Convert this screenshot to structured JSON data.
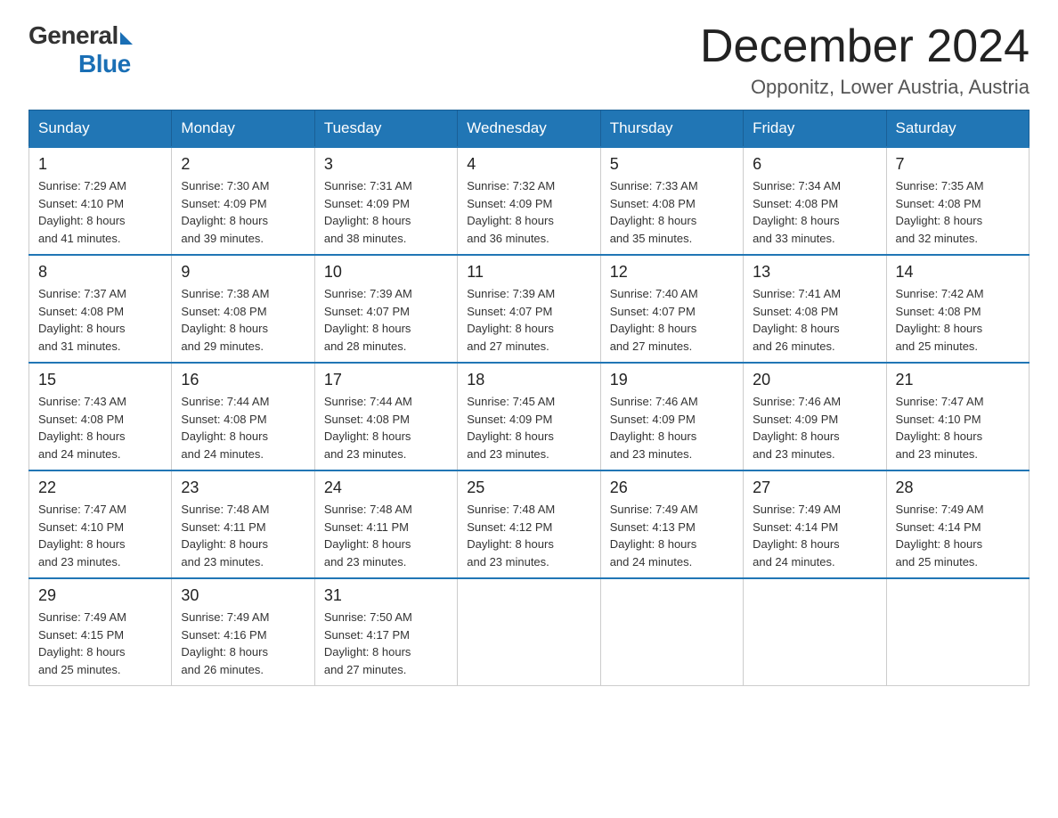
{
  "logo": {
    "general": "General",
    "blue": "Blue"
  },
  "title": "December 2024",
  "subtitle": "Opponitz, Lower Austria, Austria",
  "days_header": [
    "Sunday",
    "Monday",
    "Tuesday",
    "Wednesday",
    "Thursday",
    "Friday",
    "Saturday"
  ],
  "weeks": [
    [
      {
        "day": "1",
        "sunrise": "7:29 AM",
        "sunset": "4:10 PM",
        "daylight": "8 hours and 41 minutes."
      },
      {
        "day": "2",
        "sunrise": "7:30 AM",
        "sunset": "4:09 PM",
        "daylight": "8 hours and 39 minutes."
      },
      {
        "day": "3",
        "sunrise": "7:31 AM",
        "sunset": "4:09 PM",
        "daylight": "8 hours and 38 minutes."
      },
      {
        "day": "4",
        "sunrise": "7:32 AM",
        "sunset": "4:09 PM",
        "daylight": "8 hours and 36 minutes."
      },
      {
        "day": "5",
        "sunrise": "7:33 AM",
        "sunset": "4:08 PM",
        "daylight": "8 hours and 35 minutes."
      },
      {
        "day": "6",
        "sunrise": "7:34 AM",
        "sunset": "4:08 PM",
        "daylight": "8 hours and 33 minutes."
      },
      {
        "day": "7",
        "sunrise": "7:35 AM",
        "sunset": "4:08 PM",
        "daylight": "8 hours and 32 minutes."
      }
    ],
    [
      {
        "day": "8",
        "sunrise": "7:37 AM",
        "sunset": "4:08 PM",
        "daylight": "8 hours and 31 minutes."
      },
      {
        "day": "9",
        "sunrise": "7:38 AM",
        "sunset": "4:08 PM",
        "daylight": "8 hours and 29 minutes."
      },
      {
        "day": "10",
        "sunrise": "7:39 AM",
        "sunset": "4:07 PM",
        "daylight": "8 hours and 28 minutes."
      },
      {
        "day": "11",
        "sunrise": "7:39 AM",
        "sunset": "4:07 PM",
        "daylight": "8 hours and 27 minutes."
      },
      {
        "day": "12",
        "sunrise": "7:40 AM",
        "sunset": "4:07 PM",
        "daylight": "8 hours and 27 minutes."
      },
      {
        "day": "13",
        "sunrise": "7:41 AM",
        "sunset": "4:08 PM",
        "daylight": "8 hours and 26 minutes."
      },
      {
        "day": "14",
        "sunrise": "7:42 AM",
        "sunset": "4:08 PM",
        "daylight": "8 hours and 25 minutes."
      }
    ],
    [
      {
        "day": "15",
        "sunrise": "7:43 AM",
        "sunset": "4:08 PM",
        "daylight": "8 hours and 24 minutes."
      },
      {
        "day": "16",
        "sunrise": "7:44 AM",
        "sunset": "4:08 PM",
        "daylight": "8 hours and 24 minutes."
      },
      {
        "day": "17",
        "sunrise": "7:44 AM",
        "sunset": "4:08 PM",
        "daylight": "8 hours and 23 minutes."
      },
      {
        "day": "18",
        "sunrise": "7:45 AM",
        "sunset": "4:09 PM",
        "daylight": "8 hours and 23 minutes."
      },
      {
        "day": "19",
        "sunrise": "7:46 AM",
        "sunset": "4:09 PM",
        "daylight": "8 hours and 23 minutes."
      },
      {
        "day": "20",
        "sunrise": "7:46 AM",
        "sunset": "4:09 PM",
        "daylight": "8 hours and 23 minutes."
      },
      {
        "day": "21",
        "sunrise": "7:47 AM",
        "sunset": "4:10 PM",
        "daylight": "8 hours and 23 minutes."
      }
    ],
    [
      {
        "day": "22",
        "sunrise": "7:47 AM",
        "sunset": "4:10 PM",
        "daylight": "8 hours and 23 minutes."
      },
      {
        "day": "23",
        "sunrise": "7:48 AM",
        "sunset": "4:11 PM",
        "daylight": "8 hours and 23 minutes."
      },
      {
        "day": "24",
        "sunrise": "7:48 AM",
        "sunset": "4:11 PM",
        "daylight": "8 hours and 23 minutes."
      },
      {
        "day": "25",
        "sunrise": "7:48 AM",
        "sunset": "4:12 PM",
        "daylight": "8 hours and 23 minutes."
      },
      {
        "day": "26",
        "sunrise": "7:49 AM",
        "sunset": "4:13 PM",
        "daylight": "8 hours and 24 minutes."
      },
      {
        "day": "27",
        "sunrise": "7:49 AM",
        "sunset": "4:14 PM",
        "daylight": "8 hours and 24 minutes."
      },
      {
        "day": "28",
        "sunrise": "7:49 AM",
        "sunset": "4:14 PM",
        "daylight": "8 hours and 25 minutes."
      }
    ],
    [
      {
        "day": "29",
        "sunrise": "7:49 AM",
        "sunset": "4:15 PM",
        "daylight": "8 hours and 25 minutes."
      },
      {
        "day": "30",
        "sunrise": "7:49 AM",
        "sunset": "4:16 PM",
        "daylight": "8 hours and 26 minutes."
      },
      {
        "day": "31",
        "sunrise": "7:50 AM",
        "sunset": "4:17 PM",
        "daylight": "8 hours and 27 minutes."
      },
      null,
      null,
      null,
      null
    ]
  ],
  "labels": {
    "sunrise": "Sunrise:",
    "sunset": "Sunset:",
    "daylight": "Daylight:"
  }
}
